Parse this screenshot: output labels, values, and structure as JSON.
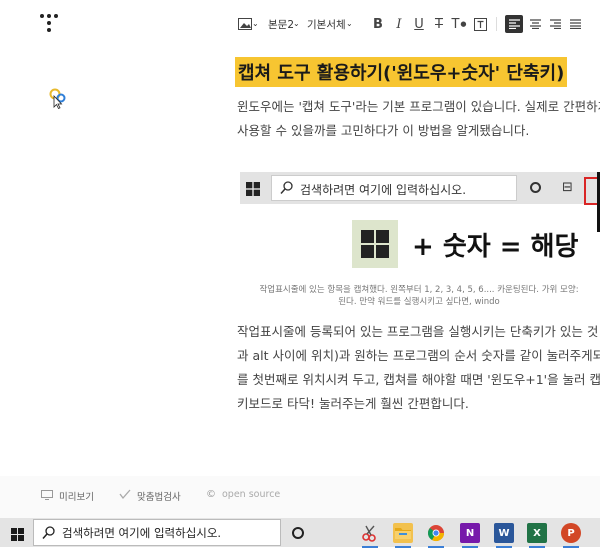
{
  "toolbar": {
    "paragraph_style": "본문2",
    "font_family": "기본서체",
    "buttons": [
      "bold",
      "italic",
      "underline",
      "strikethrough",
      "text-color",
      "text-background",
      "align-left",
      "align-center",
      "align-right",
      "align-justify"
    ]
  },
  "post": {
    "title": "캡쳐 도구 활용하기('윈도우+숫자' 단축키)",
    "intro_lines": [
      "윈도우에는 '캡쳐 도구'라는 기본 프로그램이 있습니다. 실제로 간편하게",
      "사용할 수 있을까를 고민하다가 이 방법을 알게됐습니다."
    ],
    "image": {
      "search_text": "검색하려면 여기에 입력하십시오.",
      "formula": "+ 숫자 = 해당"
    },
    "caption_lines": [
      "작업표시줄에 있는 항목을 캡쳐했다. 왼쪽부터 1, 2, 3, 4, 5, 6.... 카운팅된다. 가위 모양:",
      "된다. 만약 워드를 실행시키고 싶다면, windo"
    ],
    "body_lines": [
      "작업표시줄에 등록되어 있는 프로그램을 실행시키는 단축키가 있는 것",
      "과 alt 사이에 위치)과 원하는 프로그램의 순서 숫자를 같이 눌러주게되",
      "를 첫번째로 위치시켜 두고, 캡쳐를 해야할 때면 '윈도우+1'을 눌러 캡쳐",
      "키보드로 타닥! 눌러주는게 훨씬 간편합니다."
    ]
  },
  "bottom_bar": {
    "preview": "미리보기",
    "spellcheck": "맞춤법검사",
    "open_source": "open source"
  },
  "taskbar": {
    "search_text": "검색하려면 여기에 입력하십시오.",
    "apps": [
      {
        "name": "snipping-tool",
        "color": "#c9d6e8"
      },
      {
        "name": "file-explorer",
        "color": "#f2c14e"
      },
      {
        "name": "chrome",
        "color": "#db4437"
      },
      {
        "name": "onenote",
        "color": "#7719aa",
        "letter": "N"
      },
      {
        "name": "word",
        "color": "#2b579a",
        "letter": "W"
      },
      {
        "name": "excel",
        "color": "#217346",
        "letter": "X"
      },
      {
        "name": "powerpoint",
        "color": "#d24726",
        "letter": "P"
      }
    ]
  },
  "colors": {
    "title_highlight": "#f7c531",
    "accent_red": "#d92525"
  }
}
